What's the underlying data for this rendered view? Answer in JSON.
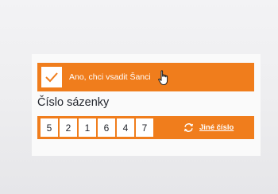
{
  "confirm": {
    "checked": true,
    "label": "Ano, chci vsadit Šanci"
  },
  "ticket": {
    "title": "Číslo sázenky",
    "digits": [
      "5",
      "2",
      "1",
      "6",
      "4",
      "7"
    ],
    "other_number_label": "Jiné číslo"
  },
  "icons": {
    "checkbox": "checkmark-icon",
    "refresh": "refresh-icon",
    "cursor": "hand-pointer-cursor-icon"
  },
  "colors": {
    "accent": "#f07d1c",
    "text": "#23262e",
    "tile": "#ffffff"
  }
}
